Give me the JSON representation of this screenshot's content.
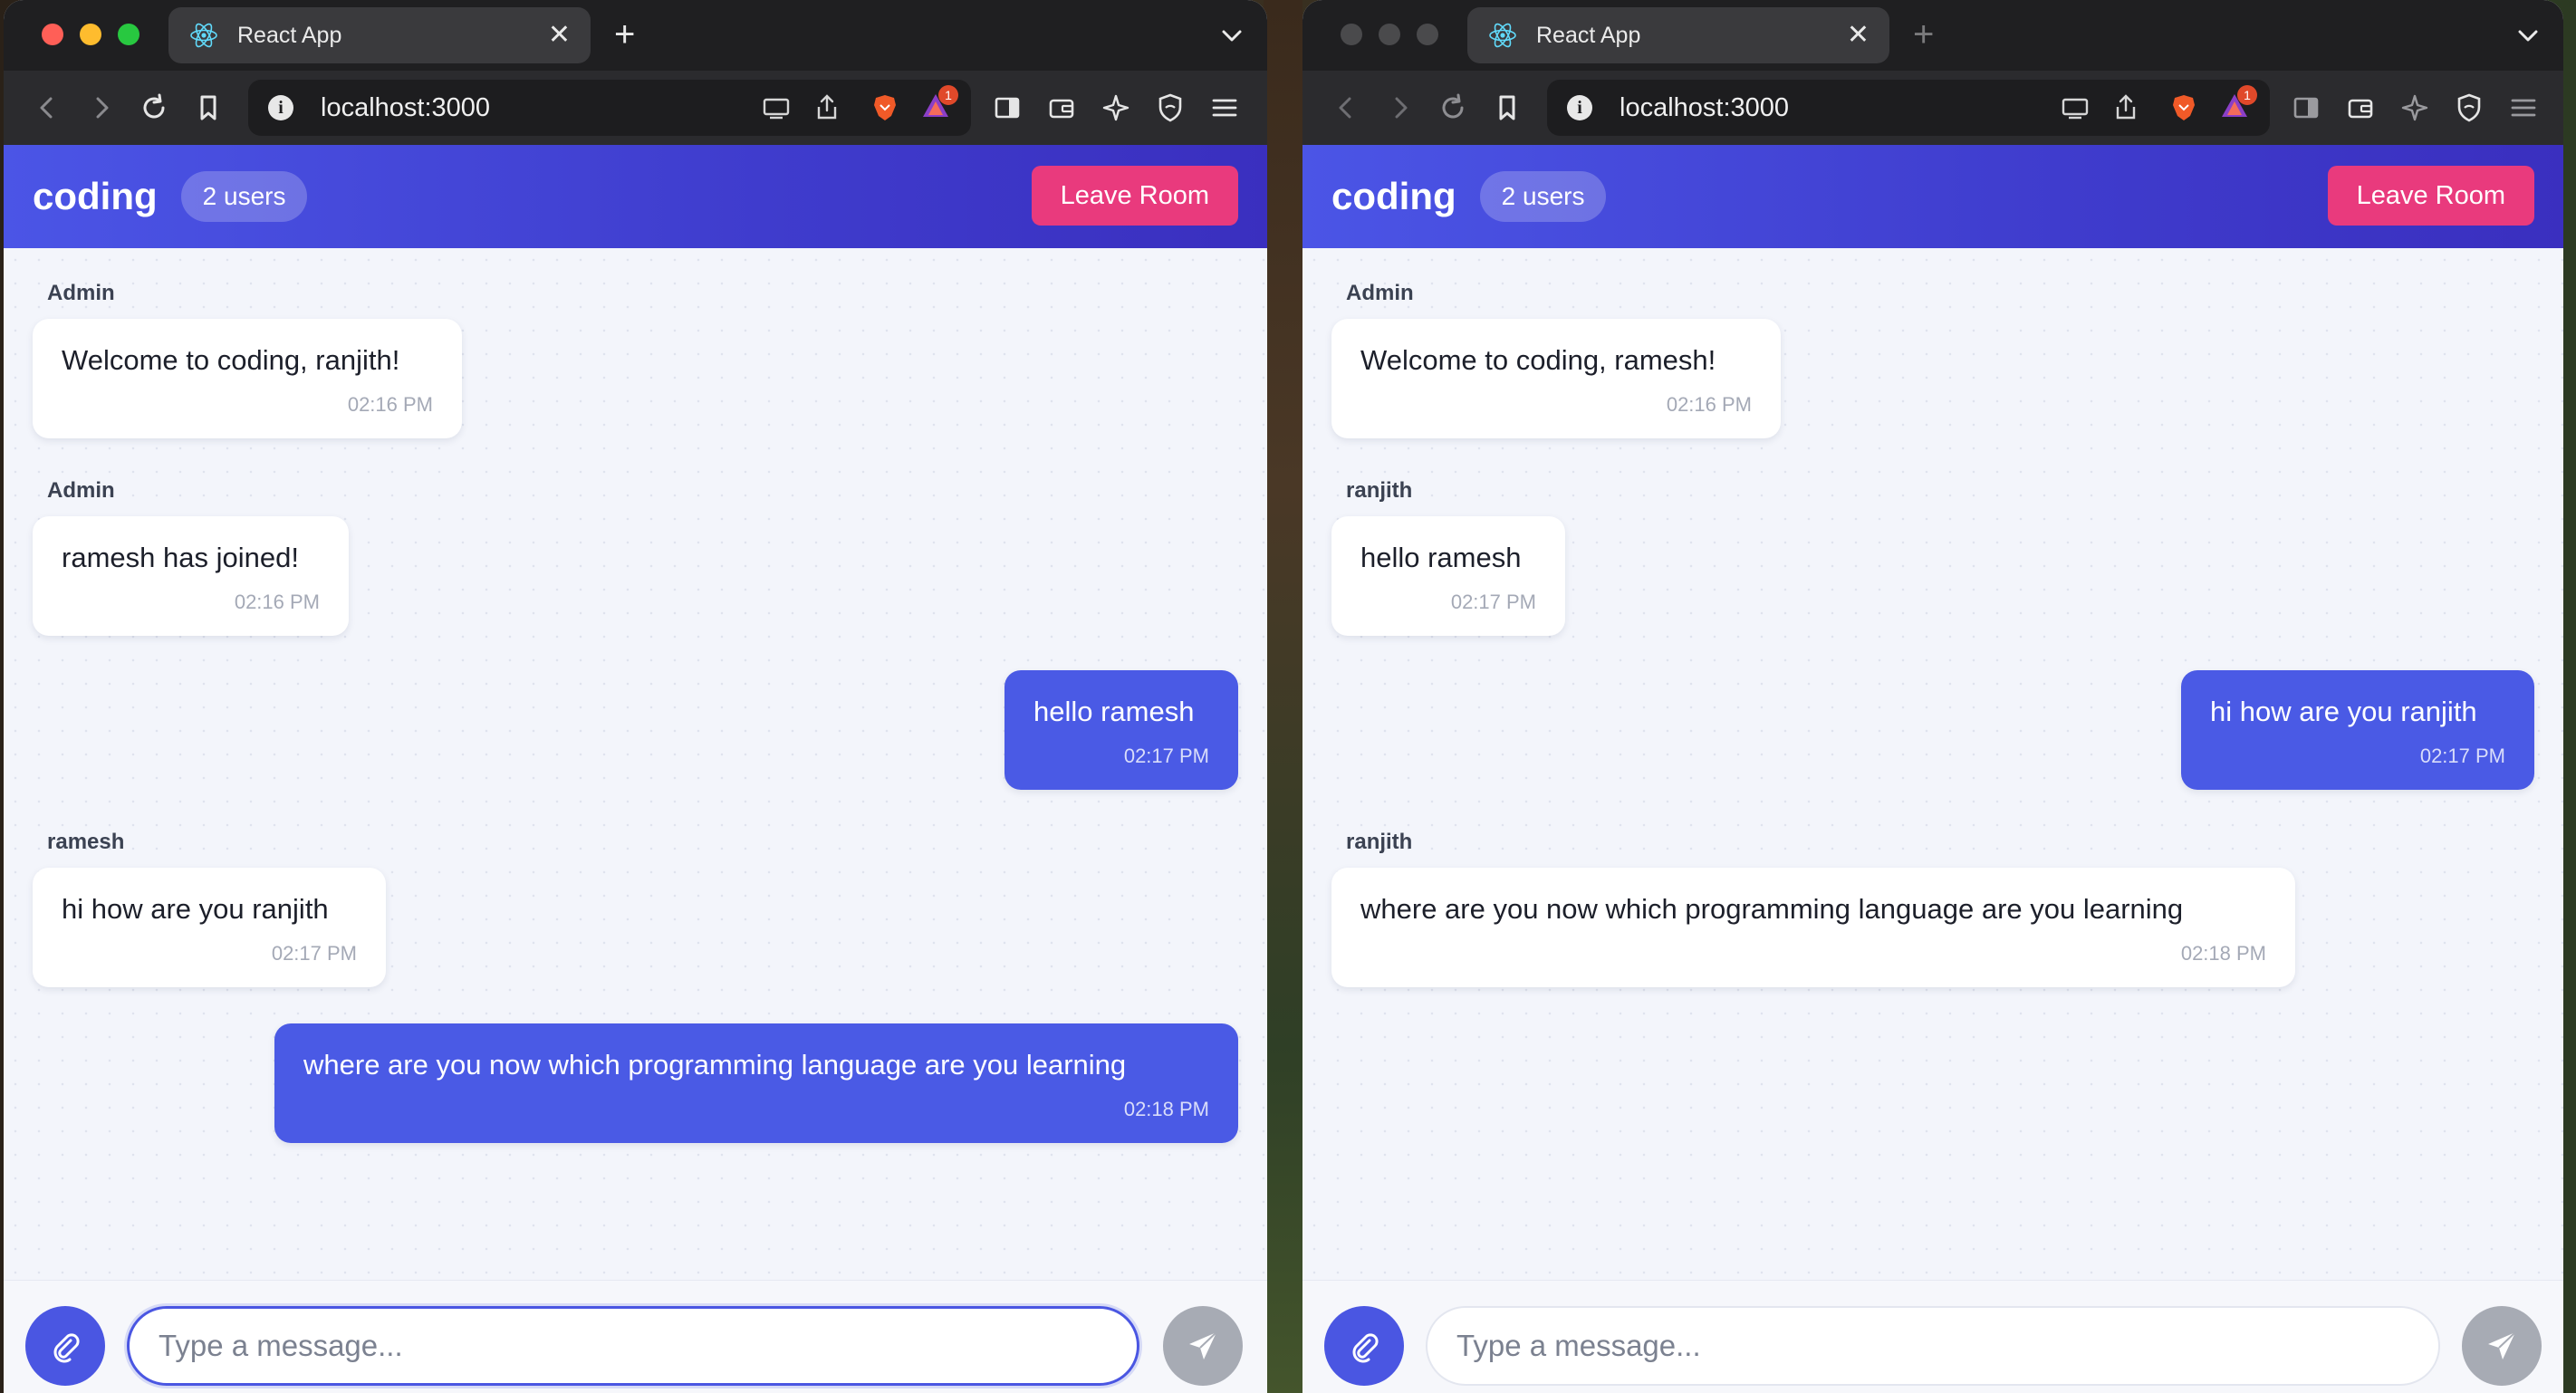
{
  "windows": [
    {
      "tab_title": "React App",
      "url": "localhost:3000",
      "shields_badge": "1",
      "room_name": "coding",
      "users_pill": "2 users",
      "leave_label": "Leave Room",
      "input_placeholder": "Type a message...",
      "messages": [
        {
          "sender": "Admin",
          "text": "Welcome to coding, ranjith!",
          "time": "02:16 PM",
          "own": false
        },
        {
          "sender": "Admin",
          "text": "ramesh has joined!",
          "time": "02:16 PM",
          "own": false
        },
        {
          "sender": "",
          "text": "hello ramesh",
          "time": "02:17 PM",
          "own": true
        },
        {
          "sender": "ramesh",
          "text": "hi how are you ranjith",
          "time": "02:17 PM",
          "own": false
        },
        {
          "sender": "",
          "text": "where are you now which programming language are you learning",
          "time": "02:18 PM",
          "own": true
        }
      ]
    },
    {
      "tab_title": "React App",
      "url": "localhost:3000",
      "shields_badge": "1",
      "room_name": "coding",
      "users_pill": "2 users",
      "leave_label": "Leave Room",
      "input_placeholder": "Type a message...",
      "messages": [
        {
          "sender": "Admin",
          "text": "Welcome to coding, ramesh!",
          "time": "02:16 PM",
          "own": false
        },
        {
          "sender": "ranjith",
          "text": "hello ramesh",
          "time": "02:17 PM",
          "own": false
        },
        {
          "sender": "",
          "text": "hi how are you ranjith",
          "time": "02:17 PM",
          "own": true
        },
        {
          "sender": "ranjith",
          "text": "where are you now which programming language are you learning",
          "time": "02:18 PM",
          "own": false
        }
      ]
    }
  ],
  "colors": {
    "header_start": "#4b55e6",
    "header_end": "#3a2fbf",
    "leave_button": "#e93a7d",
    "own_bubble": "#4a5ae5",
    "send_button": "#a7abb4"
  }
}
